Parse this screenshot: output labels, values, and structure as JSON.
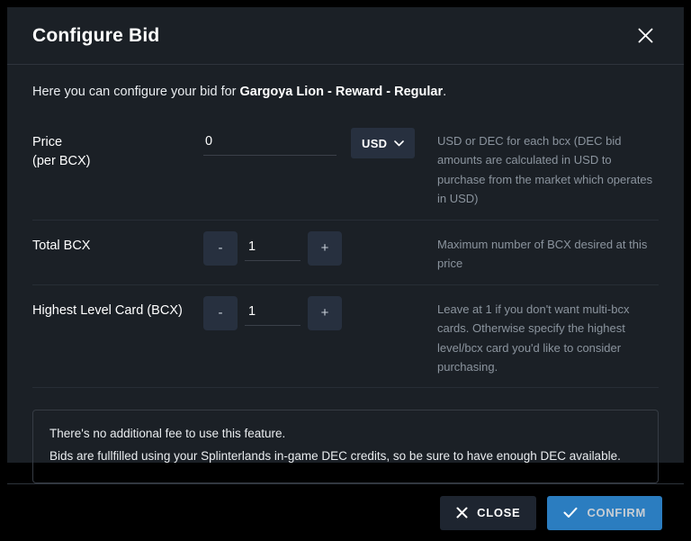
{
  "dialog": {
    "title": "Configure Bid",
    "close_icon": "close-icon",
    "intro_prefix": "Here you can configure your bid for ",
    "intro_card": "Gargoya Lion - Reward - Regular",
    "intro_suffix": "."
  },
  "rows": {
    "price": {
      "label": "Price",
      "sub_label": "(per BCX)",
      "value": "0",
      "placeholder": "0",
      "currency": "USD",
      "currency_icon": "chevron-down-icon",
      "hint": "USD or DEC for each bcx (DEC bid amounts are calculated in USD to purchase from the market which operates in USD)"
    },
    "total_bcx": {
      "label": "Total BCX",
      "value": "1",
      "decrement_label": "-",
      "increment_label": "+",
      "hint": "Maximum number of BCX desired at this price"
    },
    "highest_level": {
      "label": "Highest Level Card (BCX)",
      "value": "1",
      "decrement_label": "-",
      "increment_label": "+",
      "hint": "Leave at 1 if you don't want multi-bcx cards. Otherwise specify the highest level/bcx card you'd like to consider purchasing."
    }
  },
  "note": {
    "line1": "There's no additional fee to use this feature.",
    "line2": "Bids are fullfilled using your Splinterlands in-game DEC credits, so be sure to have enough DEC available."
  },
  "footer": {
    "close_label": "CLOSE",
    "close_icon": "x-icon",
    "confirm_label": "CONFIRM",
    "confirm_icon": "check-icon"
  },
  "colors": {
    "dialog_bg": "#1b2026",
    "control_bg": "#27303f",
    "confirm_blue": "#2b7dc0",
    "hint_text": "#8b949e",
    "divider": "#2e343c"
  }
}
